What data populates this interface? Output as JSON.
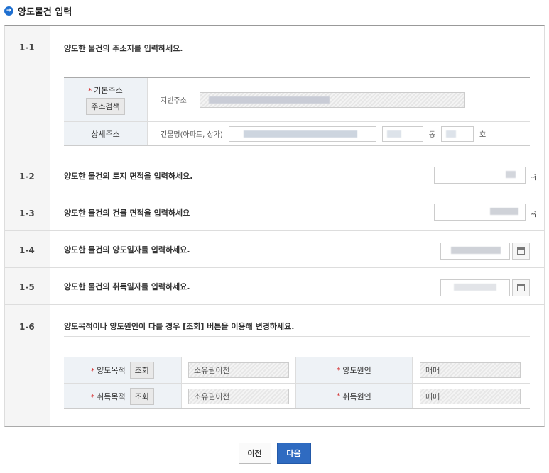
{
  "title": "양도물건 입력",
  "colors": {
    "accent": "#2f6bc1",
    "required": "#d21a1a",
    "label_bg": "#eef2f6"
  },
  "rows": {
    "r1": {
      "num": "1-1",
      "question": "양도한 물건의 주소지를 입력하세요.",
      "basic_addr_label": "기본주소",
      "addr_search_button": "주소검색",
      "jibun_label": "지번주소",
      "detail_addr_label": "상세주소",
      "building_label": "건물명(아파트, 상가)",
      "dong_suffix": "동",
      "ho_suffix": "호"
    },
    "r2": {
      "num": "1-2",
      "question": "양도한 물건의 토지 면적을 입력하세요.",
      "unit": "㎡"
    },
    "r3": {
      "num": "1-3",
      "question": "양도한 물건의 건물 면적을 입력하세요",
      "unit": "㎡"
    },
    "r4": {
      "num": "1-4",
      "question": "양도한 물건의 양도일자를 입력하세요."
    },
    "r5": {
      "num": "1-5",
      "question": "양도한 물건의 취득일자를 입력하세요."
    },
    "r6": {
      "num": "1-6",
      "question": "양도목적이나 양도원인이 다를 경우 [조회] 버튼을 이용해 변경하세요.",
      "transfer_purpose_label": "양도목적",
      "lookup_button": "조회",
      "transfer_purpose_value": "소유권이전",
      "transfer_cause_label": "양도원인",
      "transfer_cause_value": "매매",
      "acquire_purpose_label": "취득목적",
      "acquire_purpose_value": "소유권이전",
      "acquire_cause_label": "취득원인",
      "acquire_cause_value": "매매"
    }
  },
  "buttons": {
    "prev": "이전",
    "next": "다음"
  }
}
